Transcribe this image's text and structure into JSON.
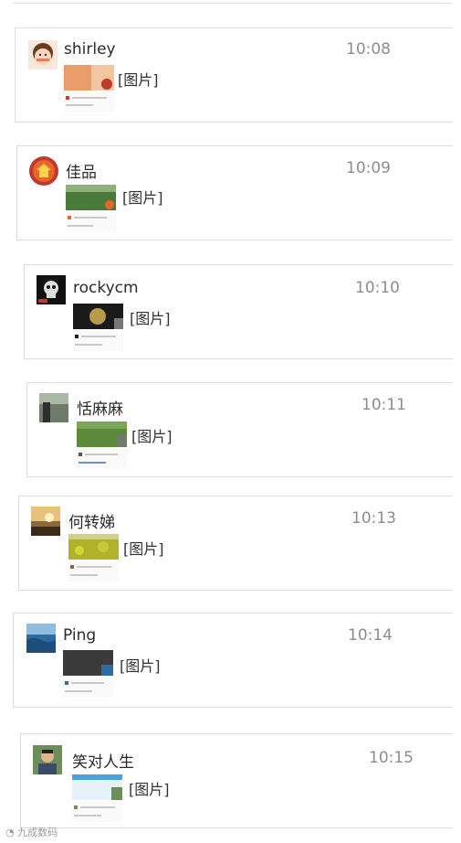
{
  "messages": [
    {
      "name": "shirley",
      "time": "10:08",
      "content": "[图片]",
      "avatar_icon": "girl-cartoon-avatar-icon",
      "thumb_icon": "shared-screenshot-thumb"
    },
    {
      "name": "佳品",
      "time": "10:09",
      "content": "[图片]",
      "avatar_icon": "red-logo-avatar-icon",
      "thumb_icon": "shared-screenshot-thumb"
    },
    {
      "name": "rockycm",
      "time": "10:10",
      "content": "[图片]",
      "avatar_icon": "dark-skull-avatar-icon",
      "thumb_icon": "shared-screenshot-thumb"
    },
    {
      "name": "恬麻麻",
      "time": "10:11",
      "content": "[图片]",
      "avatar_icon": "photo-avatar-icon",
      "thumb_icon": "shared-screenshot-thumb"
    },
    {
      "name": "何转娣",
      "time": "10:13",
      "content": "[图片]",
      "avatar_icon": "sunset-avatar-icon",
      "thumb_icon": "shared-screenshot-thumb"
    },
    {
      "name": "Ping",
      "time": "10:14",
      "content": "[图片]",
      "avatar_icon": "ocean-avatar-icon",
      "thumb_icon": "shared-screenshot-thumb"
    },
    {
      "name": "笑对人生",
      "time": "10:15",
      "content": "[图片]",
      "avatar_icon": "man-photo-avatar-icon",
      "thumb_icon": "shared-screenshot-thumb"
    }
  ],
  "watermark": "九成数码",
  "colors": {
    "border": "#dcdcdc",
    "time": "#8d8d8d",
    "name": "#2b2b2b"
  }
}
